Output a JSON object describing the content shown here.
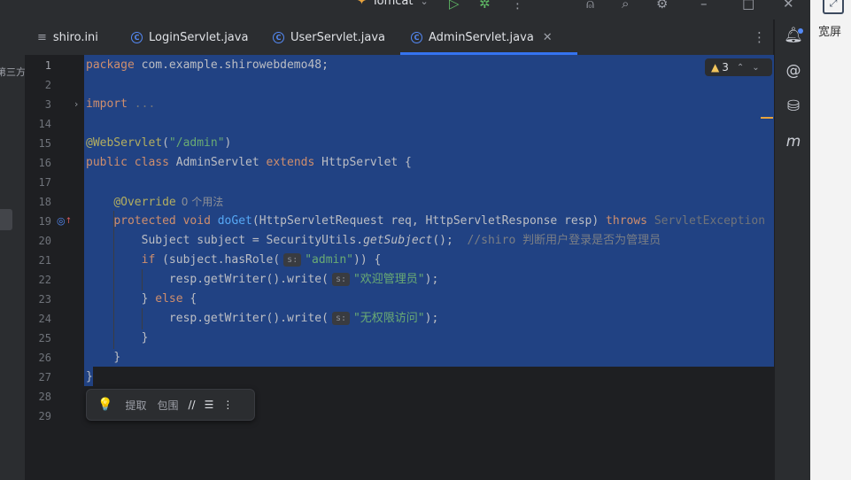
{
  "topbar": {
    "run_config": "Tomcat"
  },
  "left_strip": {
    "clipped_text": "第三方"
  },
  "tabs": [
    {
      "label": "shiro.ini",
      "type": "ini"
    },
    {
      "label": "LoginServlet.java",
      "type": "class"
    },
    {
      "label": "UserServlet.java",
      "type": "class"
    },
    {
      "label": "AdminServlet.java",
      "type": "class",
      "active": true
    }
  ],
  "inspection": {
    "warning_count": "3"
  },
  "gutter": {
    "line_numbers": [
      "1",
      "2",
      "3",
      "14",
      "15",
      "16",
      "17",
      "18",
      "19",
      "20",
      "21",
      "22",
      "23",
      "24",
      "25",
      "26",
      "27",
      "28",
      "29"
    ]
  },
  "code": {
    "l1_package_kw": "package",
    "l1_package_name": " com.example.shirowebdemo48;",
    "l3_import_kw": "import",
    "l3_import_fold": " ...",
    "l15_annotation": "@WebServlet",
    "l15_open": "(",
    "l15_string": "\"/admin\"",
    "l15_close": ")",
    "l16_public": "public",
    "l16_class": "class",
    "l16_name": " AdminServlet ",
    "l16_extends": "extends",
    "l16_rest": " HttpServlet {",
    "l18_override": "@Override",
    "l18_usages": "0 个用法",
    "l19_protected": "protected",
    "l19_void": "void",
    "l19_method": "doGet",
    "l19_params": "(HttpServletRequest req, HttpServletResponse resp) ",
    "l19_throws": "throws",
    "l19_exception": " ServletException",
    "l20_code": "Subject subject = SecurityUtils.",
    "l20_method": "getSubject",
    "l20_end": "();",
    "l20_comment": "//shiro 判断用户登录是否为管理员",
    "l21_if": "if",
    "l21_code": " (subject.hasRole(",
    "l21_hint": "s:",
    "l21_string": "\"admin\"",
    "l21_end": ")) {",
    "l22_code": "resp.getWriter().write(",
    "l22_hint": "s:",
    "l22_string": "\"欢迎管理员\"",
    "l22_end": ");",
    "l23_brace": "} ",
    "l23_else": "else",
    "l23_end": " {",
    "l24_code": "resp.getWriter().write(",
    "l24_hint": "s:",
    "l24_string": "\"无权限访问\"",
    "l24_end": ");",
    "l25_code": "}",
    "l26_code": "}",
    "l27_code": "}"
  },
  "float_toolbar": {
    "extract": "提取",
    "surround": "包围"
  },
  "outer_panel": {
    "label": "宽屏"
  },
  "colors": {
    "selection": "#214283",
    "keyword": "#cf8e6d",
    "string": "#6aab73",
    "annotation": "#b3ae60",
    "method": "#56a8f5",
    "accent": "#3574f0"
  }
}
